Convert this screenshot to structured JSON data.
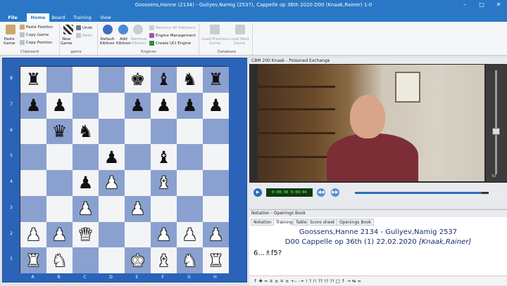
{
  "window": {
    "title": "Goossens,Hanne (2134) - Guliyev,Namig (2537), Cappelle op 36th 2020  D00  (Knaak,Rainer)  1-0"
  },
  "tabs": [
    "File",
    "Home",
    "Board",
    "Training",
    "View"
  ],
  "ribbon": {
    "clipboard": {
      "paste_game": "Paste\nGame",
      "paste_position": "Paste Position",
      "copy_game": "Copy Game",
      "copy_position": "Copy Position",
      "group": "Clipboard"
    },
    "game": {
      "new_game": "New\nGame",
      "undo": "Undo",
      "redo": "Redo",
      "group": "game"
    },
    "engines": {
      "default_kibitzer": "Default\nKibitzer",
      "add_kibitzer": "Add\nKibitzer",
      "remove_kibitzer": "Remove\nKibitzer",
      "remove_all": "Remove All Kibitzers",
      "engine_management": "Engine Management",
      "create_uci": "Create UCI Engine",
      "group": "Engines"
    },
    "database": {
      "load_previous": "Load Previous\nGame",
      "load_next": "Load Next\nGame",
      "group": "Database"
    }
  },
  "board": {
    "ranks": [
      "8",
      "7",
      "6",
      "5",
      "4",
      "3",
      "2",
      "1"
    ],
    "files": [
      "A",
      "B",
      "C",
      "D",
      "E",
      "F",
      "G",
      "H"
    ],
    "rows": [
      [
        "r",
        "",
        "",
        "",
        "k",
        "b",
        "n",
        "r"
      ],
      [
        "p",
        "p",
        "",
        "",
        "p",
        "p",
        "p",
        "p"
      ],
      [
        "",
        "q",
        "n",
        "",
        "",
        "",
        "",
        ""
      ],
      [
        "",
        "",
        "",
        "p",
        "",
        "b",
        "",
        ""
      ],
      [
        "",
        "",
        "p",
        "P",
        "",
        "B",
        "",
        ""
      ],
      [
        "",
        "",
        "P",
        "",
        "P",
        "",
        "",
        ""
      ],
      [
        "P",
        "P",
        "Q",
        "",
        "",
        "P",
        "P",
        "P"
      ],
      [
        "R",
        "N",
        "",
        "",
        "K",
        "B",
        "N",
        "R"
      ]
    ]
  },
  "video": {
    "panel_title": "CBM 200 Knaak - Poisoned Exchange",
    "time": "0:08:38  0:09:04",
    "volume_label": "50"
  },
  "notation": {
    "panel_title": "Notation - Openings Book",
    "tabs": [
      "Notation",
      "Training",
      "Table",
      "Score sheet",
      "Openings Book"
    ],
    "white": "Goossens,Hanne",
    "white_elo": "2134",
    "black": "Guliyev,Namig",
    "black_elo": "2537",
    "event_line": "D00 Cappelle op 36th (1) 22.02.2020",
    "annotator": "[Knaak,Rainer]",
    "move": "6...♗f5?",
    "toolbar": "↑  ✚  =  ∓  ±  ∓  ±  +–  –+  !  ?  !!  ??  !?  ?!  □  ↑  →  ⇆  ∞"
  },
  "colors": {
    "accent": "#2a78c5",
    "board_dark": "#8aa0cf",
    "board_light": "#f3f4f6"
  }
}
